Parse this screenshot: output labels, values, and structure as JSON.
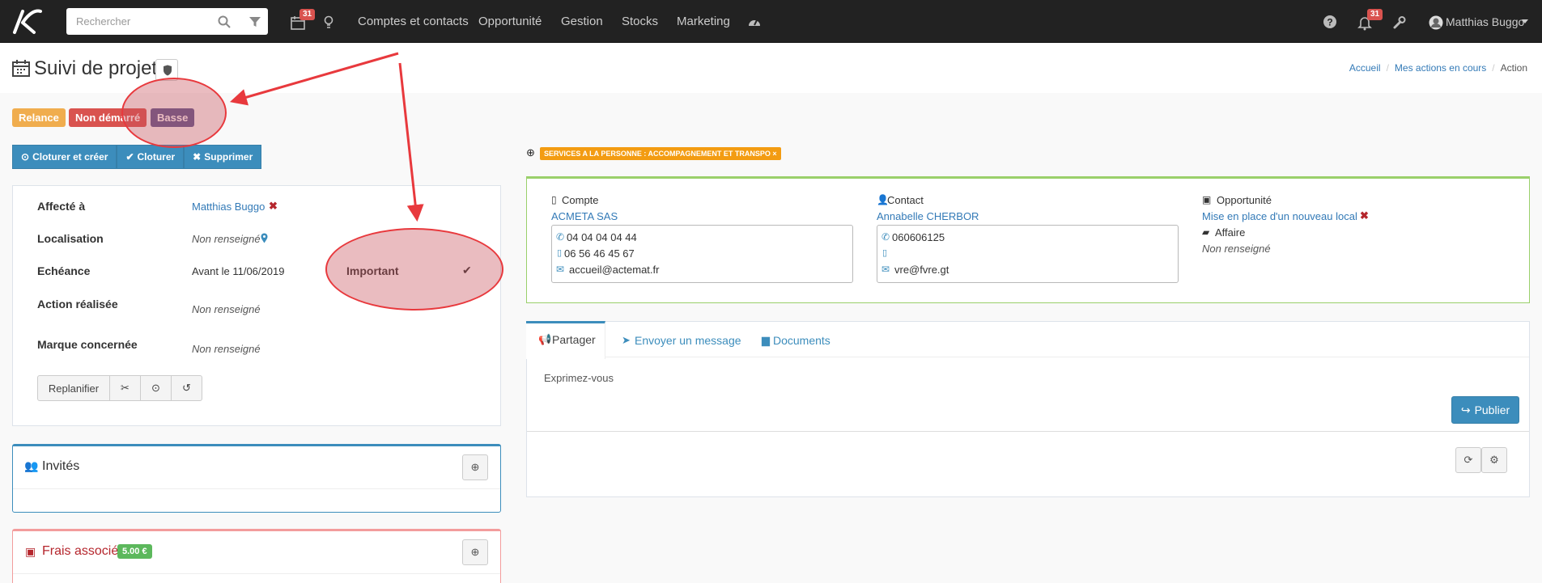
{
  "navbar": {
    "search_placeholder": "Rechercher",
    "calendar_badge": "31",
    "menu": [
      "Comptes et contacts",
      "Opportunité",
      "Gestion",
      "Stocks",
      "Marketing"
    ],
    "notif_badge": "31",
    "user_name": "Matthias Buggo"
  },
  "page": {
    "title": "Suivi de projet",
    "breadcrumb": [
      "Accueil",
      "Mes actions en cours",
      "Action"
    ]
  },
  "labels": {
    "relance": "Relance",
    "status": "Non démarré",
    "priority": "Basse"
  },
  "actions": {
    "close_create": "Cloturer et créer",
    "close": "Cloturer",
    "delete": "Supprimer"
  },
  "details": {
    "assigned_label": "Affecté à",
    "assigned_value": "Matthias Buggo",
    "location_label": "Localisation",
    "location_value": "Non renseigné",
    "due_label": "Echéance",
    "due_value": "Avant le 11/06/2019",
    "important_label": "Important",
    "done_label": "Action réalisée",
    "done_value": "Non renseigné",
    "brand_label": "Marque concernée",
    "brand_value": "Non renseigné",
    "reschedule": "Replanifier"
  },
  "invites": {
    "title": "Invités"
  },
  "fees": {
    "title": "Frais associés",
    "amount": "5.00 €"
  },
  "tag": {
    "text": "SERVICES A LA PERSONNE : ACCOMPAGNEMENT ET TRANSPO"
  },
  "account": {
    "label": "Compte",
    "name": "ACMETA SAS",
    "phone": "04 04 04 04 44",
    "mobile": "06 56 46 45 67",
    "email": "accueil@actemat.fr"
  },
  "contact": {
    "label": "Contact",
    "name": "Annabelle CHERBOR",
    "phone": "060606125",
    "mobile": "",
    "email": "vre@fvre.gt"
  },
  "opportunity": {
    "label": "Opportunité",
    "name": "Mise en place d'un nouveau local",
    "affaire_label": "Affaire",
    "affaire_value": "Non renseigné"
  },
  "share": {
    "tabs": [
      "Partager",
      "Envoyer un message",
      "Documents"
    ],
    "placeholder": "Exprimez-vous",
    "publish": "Publier"
  },
  "colors": {
    "navbar": "#222222",
    "relance": "#f0ad4e",
    "status": "#d9534f",
    "priority": "#5a5a92",
    "primary": "#3c8dbc",
    "tag": "#f39c12",
    "success_border": "#9ad06b",
    "danger_border": "#f39c9c",
    "fee_badge": "#5cb85c"
  }
}
